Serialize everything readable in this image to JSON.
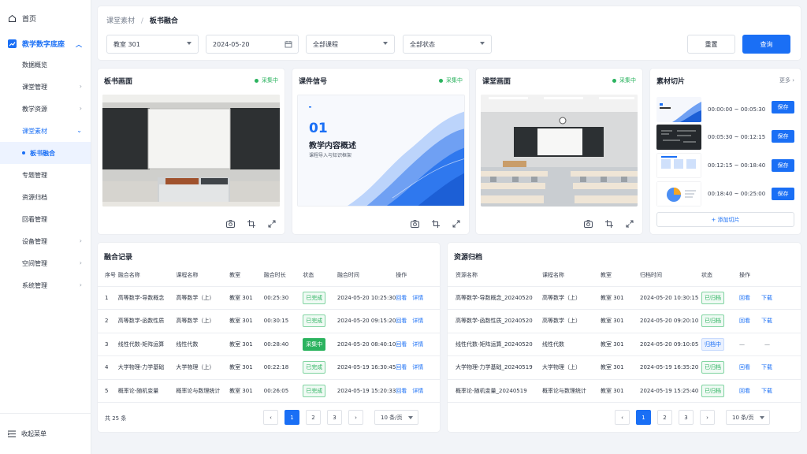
{
  "sidebar": {
    "home": "首页",
    "group": "教学数字底座",
    "items": [
      {
        "label": "数据概览",
        "chev": false
      },
      {
        "label": "课堂管理",
        "chev": true
      },
      {
        "label": "教学资源",
        "chev": true
      },
      {
        "label": "课堂素材",
        "chev": true,
        "open": true
      }
    ],
    "active_leaf": "板书融合",
    "items2": [
      {
        "label": "专题管理",
        "chev": false
      },
      {
        "label": "资源归档",
        "chev": false
      },
      {
        "label": "回看管理",
        "chev": false
      },
      {
        "label": "设备管理",
        "chev": true
      },
      {
        "label": "空间管理",
        "chev": true
      },
      {
        "label": "系统管理",
        "chev": true
      }
    ],
    "collapse": "收起菜单"
  },
  "breadcrumb": {
    "parent": "课堂素材",
    "sep": "/",
    "current": "板书融合"
  },
  "filters": {
    "room": "教室 301",
    "date": "2024-05-20",
    "course": "全部课程",
    "status": "全部状态",
    "reset": "重置",
    "query": "查询"
  },
  "panels": {
    "board": {
      "title": "板书画面",
      "status": "采集中"
    },
    "courseware": {
      "title": "课件信号",
      "status": "采集中",
      "slide_num": "01",
      "slide_title": "教学内容概述",
      "slide_sub": "课程导入与知识框架"
    },
    "class": {
      "title": "课堂画面",
      "status": "采集中"
    }
  },
  "clips": {
    "title": "素材切片",
    "more": "更多",
    "items": [
      {
        "time": "00:00:00 ~ 00:05:30",
        "save": "保存",
        "thumb_title": "教学内容概述"
      },
      {
        "time": "00:05:30 ~ 00:12:15",
        "save": "保存"
      },
      {
        "time": "00:12:15 ~ 00:18:40",
        "save": "保存"
      },
      {
        "time": "00:18:40 ~ 00:25:00",
        "save": "保存"
      }
    ],
    "add": "+ 添加切片"
  },
  "fusion": {
    "title": "融合记录",
    "headers": [
      "序号",
      "融合名称",
      "课程名称",
      "教室",
      "融合时长",
      "状态",
      "融合时间",
      "操作"
    ],
    "rows": [
      {
        "no": "1",
        "name": "高等数学-导数概念",
        "course": "高等数学（上）",
        "room": "教室 301",
        "dur": "00:25:30",
        "status": "已完成",
        "status_type": "done",
        "time": "2024-05-20 10:25:30",
        "op1": "回看",
        "op2": "详情"
      },
      {
        "no": "2",
        "name": "高等数学-函数性质",
        "course": "高等数学（上）",
        "room": "教室 301",
        "dur": "00:30:15",
        "status": "已完成",
        "status_type": "done",
        "time": "2024-05-20 09:15:20",
        "op1": "回看",
        "op2": "详情"
      },
      {
        "no": "3",
        "name": "线性代数-矩阵运算",
        "course": "线性代数",
        "room": "教室 301",
        "dur": "00:28:40",
        "status": "采集中",
        "status_type": "live",
        "time": "2024-05-20 08:40:10",
        "op1": "回看",
        "op2": "详情"
      },
      {
        "no": "4",
        "name": "大学物理-力学基础",
        "course": "大学物理（上）",
        "room": "教室 301",
        "dur": "00:22:18",
        "status": "已完成",
        "status_type": "done",
        "time": "2024-05-19 16:30:45",
        "op1": "回看",
        "op2": "详情"
      },
      {
        "no": "5",
        "name": "概率论-随机变量",
        "course": "概率论与数理统计",
        "room": "教室 301",
        "dur": "00:26:05",
        "status": "已完成",
        "status_type": "done",
        "time": "2024-05-19 15:20:33",
        "op1": "回看",
        "op2": "详情"
      }
    ],
    "total": "共 25 条",
    "pages": [
      "1",
      "2",
      "3"
    ],
    "per_page": "10 条/页"
  },
  "archive": {
    "title": "资源归档",
    "headers": [
      "资源名称",
      "课程名称",
      "教室",
      "归档时间",
      "状态",
      "操作"
    ],
    "rows": [
      {
        "name": "高等数学-导数概念_20240520",
        "course": "高等数学（上）",
        "room": "教室 301",
        "time": "2024-05-20 10:30:15",
        "status": "已归档",
        "status_type": "done",
        "op1": "回看",
        "op2": "下载"
      },
      {
        "name": "高等数学-函数性质_20240520",
        "course": "高等数学（上）",
        "room": "教室 301",
        "time": "2024-05-20 09:20:10",
        "status": "已归档",
        "status_type": "done",
        "op1": "回看",
        "op2": "下载"
      },
      {
        "name": "线性代数-矩阵运算_20240520",
        "course": "线性代数",
        "room": "教室 301",
        "time": "2024-05-20 09:10:05",
        "status": "归档中",
        "status_type": "doing",
        "op1": "—",
        "op2": "—"
      },
      {
        "name": "大学物理-力学基础_20240519",
        "course": "大学物理（上）",
        "room": "教室 301",
        "time": "2024-05-19 16:35:20",
        "status": "已归档",
        "status_type": "done",
        "op1": "回看",
        "op2": "下载"
      },
      {
        "name": "概率论-随机变量_20240519",
        "course": "概率论与数理统计",
        "room": "教室 301",
        "time": "2024-05-19 15:25:40",
        "status": "已归档",
        "status_type": "done",
        "op1": "回看",
        "op2": "下载"
      }
    ],
    "pages": [
      "1",
      "2",
      "3"
    ],
    "per_page": "10 条/页"
  },
  "colors": {
    "accent": "#1a6ff5",
    "success": "#2bb35f"
  }
}
